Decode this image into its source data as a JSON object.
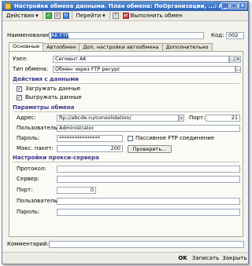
{
  "window": {
    "title": "Настройки обмена данными. План обмена: ПоОрганизации, ...: AK FTP",
    "buttons": [
      "_",
      "□",
      "×"
    ]
  },
  "toolbar": {
    "actions_label": "Действия",
    "goto_label": "Перейти",
    "execute_label": "Выполнить обмен"
  },
  "form": {
    "name_label": "Наименование:",
    "name_value": "AK FTP",
    "code_label": "Код:",
    "code_value": "002"
  },
  "tabs": [
    {
      "label": "Основные",
      "active": true
    },
    {
      "label": "Автообмен",
      "active": false
    },
    {
      "label": "Доп. настройки автообмена",
      "active": false
    },
    {
      "label": "Дополнительно",
      "active": false
    }
  ],
  "main": {
    "node_label": "Узел:",
    "node_value": "Сегмент AK",
    "exchange_type_label": "Тип обмена:",
    "exchange_type_value": "Обмен через FTP ресурс",
    "actions_section": "Действия с данными",
    "load_label": "Загружать данные",
    "load_checked": true,
    "unload_label": "Выгружать данные",
    "unload_checked": true,
    "params_section": "Параметры обмена",
    "address_label": "Адрес:",
    "address_value": "ftp://abcde.ru/consolidation/",
    "port_label": "Порт:",
    "port_value": "21",
    "user_label": "Пользователь:",
    "user_value": "Administrator",
    "password_label": "Пароль:",
    "password_value": "****************",
    "passive_label": "Пассивное FTP соединение",
    "passive_checked": false,
    "max_packet_label": "Макс. пакет:",
    "max_packet_value": "200",
    "check_button": "Проверить...",
    "proxy_section": "Настройки прокси-сервера",
    "protocol_label": "Протокол:",
    "protocol_value": "",
    "server_label": "Сервер:",
    "server_value": "",
    "proxy_port_label": "Порт:",
    "proxy_port_value": "0",
    "proxy_user_label": "Пользователь:",
    "proxy_user_value": "",
    "proxy_password_label": "Пароль:",
    "proxy_password_value": ""
  },
  "footer": {
    "comment_label": "Комментарий:",
    "comment_value": "",
    "ok_label": "OK",
    "save_label": "Записать",
    "close_label": "Закрыть"
  }
}
